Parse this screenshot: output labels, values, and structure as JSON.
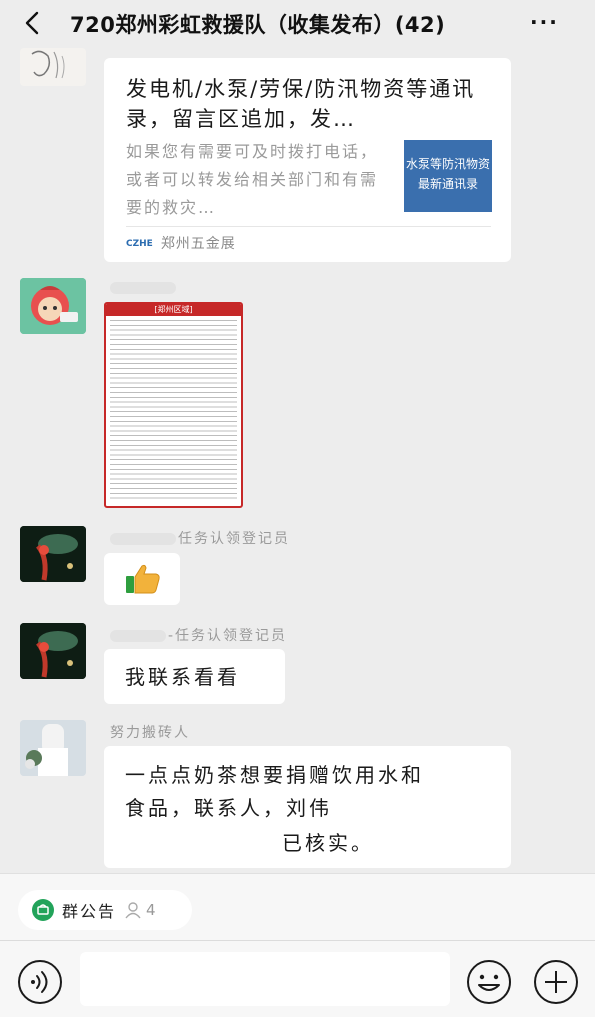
{
  "header": {
    "title": "720郑州彩虹救援队（收集发布）(42)",
    "more": "···"
  },
  "messages": {
    "card": {
      "title": "发电机/水泵/劳保/防汛物资等通讯录，留言区追加，发…",
      "description": "如果您有需要可及时拨打电话，或者可以转发给相关部门和有需要的救灾…",
      "thumbnail_line1": "水泵等防汛物资",
      "thumbnail_line2": "最新通讯录",
      "source_logo": "CZHE",
      "source": "郑州五金展"
    },
    "image": {
      "sheet_header": "[郑州区域]"
    },
    "m3": {
      "sender_suffix": "任务认领登记员"
    },
    "m4": {
      "sender_suffix": "-任务认领登记员",
      "text": "我联系看看"
    },
    "m5": {
      "sender": "努力搬砖人",
      "line1": "一点点奶茶想要捐赠饮用水和",
      "line2": "食品，联系人，刘伟",
      "line3": "已核实。"
    }
  },
  "bottom": {
    "notice_label": "群公告",
    "notice_count": "4"
  }
}
